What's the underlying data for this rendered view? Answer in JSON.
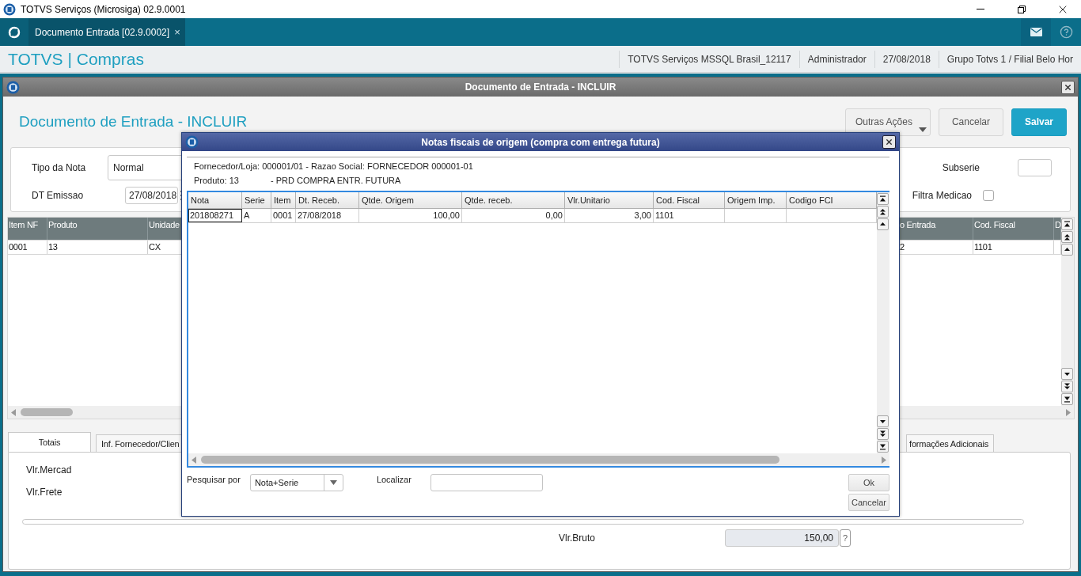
{
  "app_title": "TOTVS Serviços (Microsiga) 02.9.0001",
  "tabs": [
    {
      "label": "Documento Entrada [02.9.0002]",
      "selected": true,
      "close": "×"
    }
  ],
  "header": {
    "brand": "TOTVS | Compras",
    "info": [
      "TOTVS Serviços MSSQL Brasil_12117",
      "Administrador",
      "27/08/2018",
      "Grupo Totvs 1 / Filial Belo Hor"
    ]
  },
  "window": {
    "title": "Documento de Entrada - INCLUIR",
    "heading": "Documento de Entrada - INCLUIR",
    "actions": [
      {
        "label": "Outras Ações",
        "kind": "menu"
      },
      {
        "label": "Cancelar",
        "kind": "secondary"
      },
      {
        "label": "Salvar",
        "kind": "primary"
      }
    ]
  },
  "form": {
    "tipo_label": "Tipo da Nota",
    "tipo_value": "Normal",
    "emissao_label": "DT Emissao",
    "emissao_value": "27/08/2018",
    "subserie_label": "Subserie",
    "filtra_label": "Filtra Medicao",
    "filtra_checked": false
  },
  "items_grid": {
    "columns": [
      "Item NF",
      "Produto",
      "Unidade",
      "o Entrada",
      "Cod. Fiscal",
      "D"
    ],
    "rows": [
      [
        "0001",
        "13",
        "CX",
        "2",
        "1101"
      ]
    ]
  },
  "bottom_tabs": [
    {
      "label": "Totais",
      "selected": true
    },
    {
      "label": "Inf. Fornecedor/Clien",
      "selected": false
    },
    {
      "label": "formações Adicionais",
      "selected": false
    }
  ],
  "totals": {
    "labels": [
      "Vlr.Mercad",
      "Vlr.Frete"
    ],
    "bruto_label": "Vlr.Bruto",
    "bruto_value": "150,00",
    "help": "?"
  },
  "dialog": {
    "title": "Notas fiscais de origem (compra com entrega futura)",
    "supplier": "Fornecedor/Loja: 000001/01 - Razao Social: FORNECEDOR 000001-01",
    "product_label": "Produto: 13",
    "product_desc": "- PRD COMPRA ENTR. FUTURA",
    "columns": [
      {
        "label": "Nota",
        "kind": "text"
      },
      {
        "label": "Serie",
        "kind": "text"
      },
      {
        "label": "Item",
        "kind": "text"
      },
      {
        "label": "Dt. Receb.",
        "kind": "text"
      },
      {
        "label": "Qtde. Origem",
        "kind": "number"
      },
      {
        "label": "Qtde. receb.",
        "kind": "number"
      },
      {
        "label": "Vlr.Unitario",
        "kind": "number"
      },
      {
        "label": "Cod. Fiscal",
        "kind": "text"
      },
      {
        "label": "Origem Imp.",
        "kind": "text"
      },
      {
        "label": "Codigo FCI",
        "kind": "text"
      }
    ],
    "rows": [
      {
        "selected": true,
        "cells": [
          "201808271",
          "A",
          "0001",
          "27/08/2018",
          "100,00",
          "0,00",
          "3,00",
          "1101"
        ]
      }
    ],
    "search_label": "Pesquisar por",
    "search_by": "Nota+Serie",
    "find_label": "Localizar",
    "buttons": [
      "Ok",
      "Cancelar"
    ]
  }
}
